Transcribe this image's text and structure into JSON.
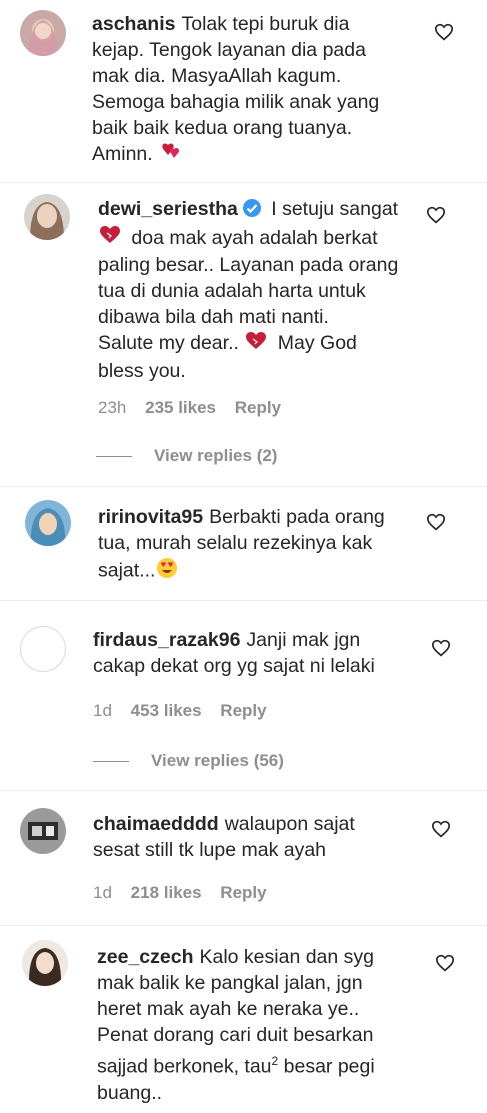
{
  "comments": [
    {
      "username": "aschanis",
      "lines": [
        "Tolak tepi buruk dia",
        "kejap. Tengok layanan dia pada",
        "mak dia. MasyaAllah kagum.",
        "Semoga bahagia milik anak yang",
        "baik baik kedua orang tuanya.",
        "Aminn."
      ]
    },
    {
      "username": "dewi_seriestha",
      "lines": [
        "I setuju sangat",
        "doa mak ayah adalah berkat",
        "paling besar.. Layanan pada orang",
        "tua di dunia adalah harta untuk",
        "dibawa bila dah mati nanti.",
        "Salute my dear..",
        "May God",
        "bless you."
      ],
      "time": "23h",
      "likes": "235 likes",
      "reply": "Reply",
      "view_replies": "View replies (2)"
    },
    {
      "username": "ririnovita95",
      "lines": [
        "Berbakti pada orang",
        "tua, murah selalu rezekinya kak",
        "sajat..."
      ]
    },
    {
      "username": "firdaus_razak96",
      "lines": [
        "Janji mak jgn",
        "cakap dekat org yg sajat ni lelaki"
      ],
      "time": "1d",
      "likes": "453 likes",
      "reply": "Reply",
      "view_replies": "View replies (56)"
    },
    {
      "username": "chaimaedddd",
      "lines": [
        "walaupon sajat",
        "sesat still tk lupe mak ayah"
      ],
      "time": "1d",
      "likes": "218 likes",
      "reply": "Reply"
    },
    {
      "username": "zee_czech",
      "lines": [
        "Kalo kesian dan syg",
        "mak balik ke pangkal jalan, jgn",
        "heret mak ayah ke neraka ye..",
        "Penat dorang cari duit besarkan",
        "sajjad berkonek, tau",
        "2",
        " besar pegi",
        "buang.."
      ]
    }
  ],
  "icons": {
    "like": "heart-outline-icon",
    "verified": "verified-badge-icon",
    "emoji_hearts": "two-hearts-emoji",
    "emoji_heart_eyes": "heart-eyes-emoji"
  },
  "colors": {
    "text": "#262626",
    "muted": "#8e8e8e",
    "verified": "#3897f0",
    "heart_red": "#e0245e"
  }
}
